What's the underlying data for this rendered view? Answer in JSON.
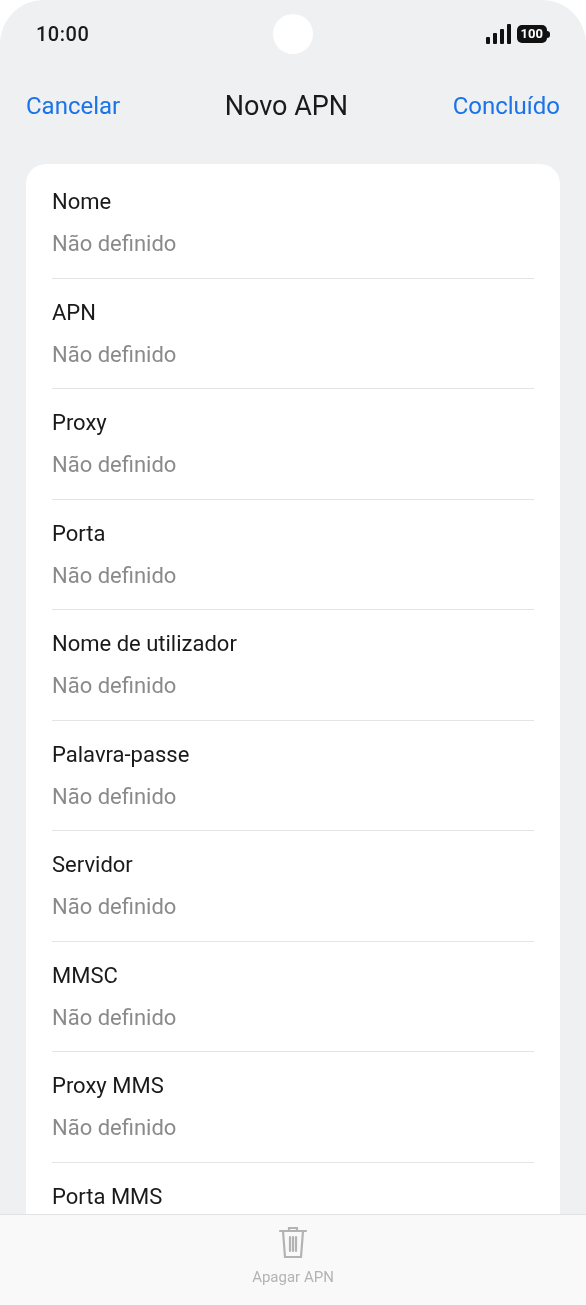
{
  "status_bar": {
    "time": "10:00",
    "battery": "100"
  },
  "header": {
    "cancel": "Cancelar",
    "title": "Novo APN",
    "done": "Concluído"
  },
  "fields": [
    {
      "label": "Nome",
      "value": "Não definido"
    },
    {
      "label": "APN",
      "value": "Não definido"
    },
    {
      "label": "Proxy",
      "value": "Não definido"
    },
    {
      "label": "Porta",
      "value": "Não definido"
    },
    {
      "label": "Nome de utilizador",
      "value": "Não definido"
    },
    {
      "label": "Palavra-passe",
      "value": "Não definido"
    },
    {
      "label": "Servidor",
      "value": "Não definido"
    },
    {
      "label": "MMSC",
      "value": "Não definido"
    },
    {
      "label": "Proxy MMS",
      "value": "Não definido"
    },
    {
      "label": "Porta MMS"
    }
  ],
  "bottom_bar": {
    "delete": "Apagar APN",
    "disabled": true
  }
}
